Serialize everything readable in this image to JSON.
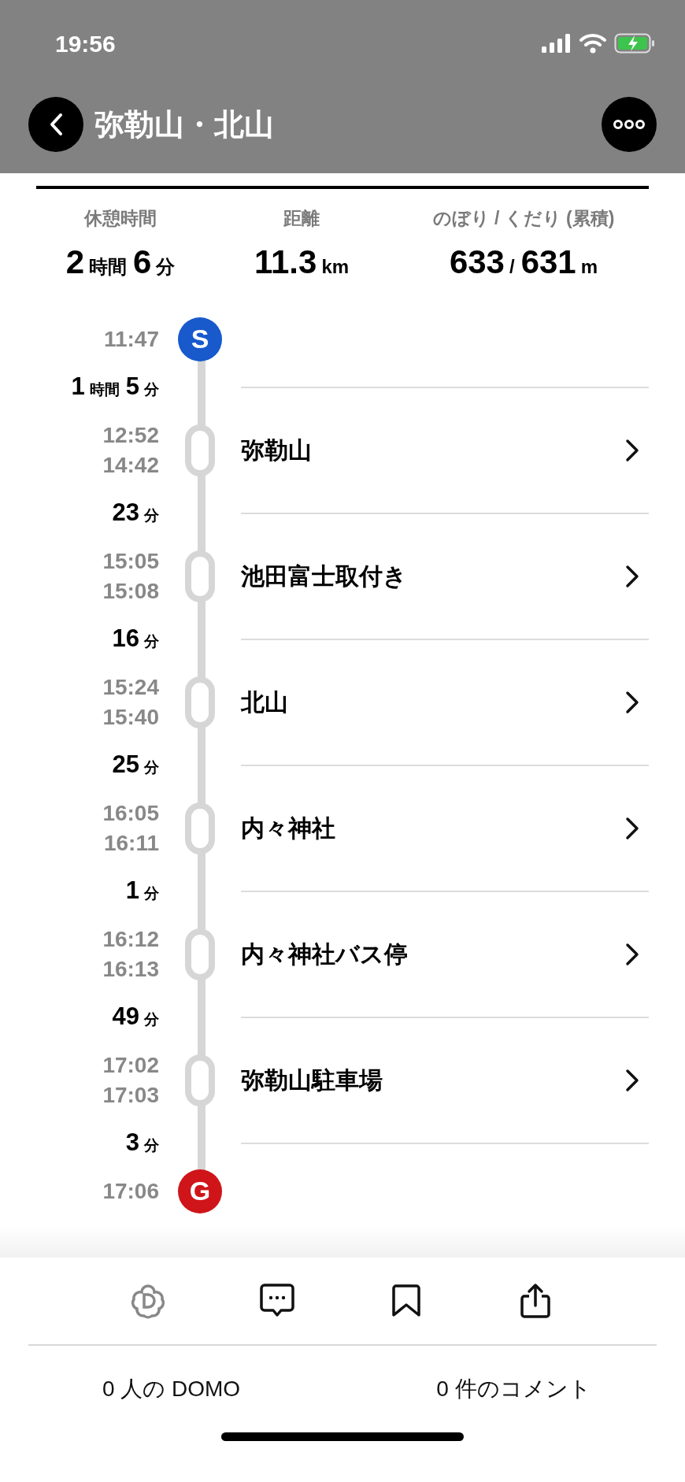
{
  "status_bar": {
    "time": "19:56"
  },
  "header": {
    "title": "弥勒山・北山"
  },
  "stats": [
    {
      "label": "休憩時間",
      "parts": [
        {
          "value": "2",
          "unit": "時間"
        },
        {
          "value": "6",
          "unit": "分"
        }
      ]
    },
    {
      "label": "距離",
      "parts": [
        {
          "value": "11.3",
          "unit": "km"
        }
      ]
    },
    {
      "label": "のぼり / くだり (累積)",
      "parts": [
        {
          "value": "633",
          "unit": "/"
        },
        {
          "value": "631",
          "unit": "m"
        }
      ]
    }
  ],
  "timeline": [
    {
      "kind": "start",
      "marker": "S",
      "color": "#1859cc",
      "time": "11:47"
    },
    {
      "kind": "duration",
      "parts": [
        {
          "value": "1",
          "unit": "時間"
        },
        {
          "value": "5",
          "unit": "分"
        }
      ]
    },
    {
      "kind": "waypoint",
      "name": "弥勒山",
      "arrive": "12:52",
      "depart": "14:42"
    },
    {
      "kind": "duration",
      "parts": [
        {
          "value": "23",
          "unit": "分"
        }
      ]
    },
    {
      "kind": "waypoint",
      "name": "池田富士取付き",
      "arrive": "15:05",
      "depart": "15:08"
    },
    {
      "kind": "duration",
      "parts": [
        {
          "value": "16",
          "unit": "分"
        }
      ]
    },
    {
      "kind": "waypoint",
      "name": "北山",
      "arrive": "15:24",
      "depart": "15:40"
    },
    {
      "kind": "duration",
      "parts": [
        {
          "value": "25",
          "unit": "分"
        }
      ]
    },
    {
      "kind": "waypoint",
      "name": "内々神社",
      "arrive": "16:05",
      "depart": "16:11"
    },
    {
      "kind": "duration",
      "parts": [
        {
          "value": "1",
          "unit": "分"
        }
      ]
    },
    {
      "kind": "waypoint",
      "name": "内々神社バス停",
      "arrive": "16:12",
      "depart": "16:13"
    },
    {
      "kind": "duration",
      "parts": [
        {
          "value": "49",
          "unit": "分"
        }
      ]
    },
    {
      "kind": "waypoint",
      "name": "弥勒山駐車場",
      "arrive": "17:02",
      "depart": "17:03"
    },
    {
      "kind": "duration",
      "parts": [
        {
          "value": "3",
          "unit": "分"
        }
      ]
    },
    {
      "kind": "goal",
      "marker": "G",
      "color": "#cf1519",
      "time": "17:06"
    }
  ],
  "counts": [
    "0 人の DOMO",
    "0 件のコメント"
  ]
}
